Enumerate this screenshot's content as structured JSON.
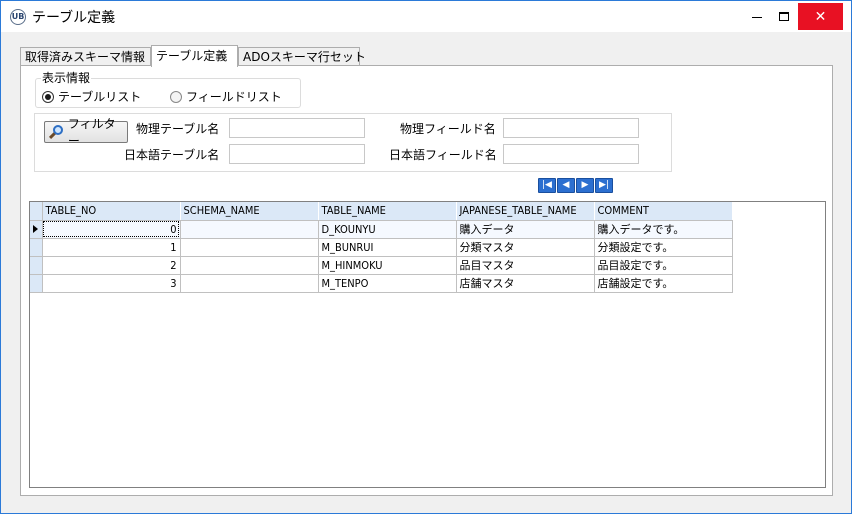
{
  "window": {
    "icon_text": "UB",
    "title": "テーブル定義",
    "close_symbol": "✕"
  },
  "tabs": [
    {
      "label": "取得済みスキーマ情報",
      "active": false
    },
    {
      "label": "テーブル定義",
      "active": true
    },
    {
      "label": "ADOスキーマ行セット",
      "active": false
    }
  ],
  "display_info": {
    "legend": "表示情報",
    "options": [
      {
        "label": "テーブルリスト",
        "checked": true
      },
      {
        "label": "フィールドリスト",
        "checked": false
      }
    ]
  },
  "filter": {
    "button_label": "フィルター",
    "physical_table_label": "物理テーブル名",
    "japanese_table_label": "日本語テーブル名",
    "physical_field_label": "物理フィールド名",
    "japanese_field_label": "日本語フィールド名",
    "physical_table_value": "",
    "japanese_table_value": "",
    "physical_field_value": "",
    "japanese_field_value": ""
  },
  "navigator": {
    "first": "|◀",
    "prev": "◀",
    "next": "▶",
    "last": "▶|"
  },
  "grid": {
    "columns": [
      "TABLE_NO",
      "SCHEMA_NAME",
      "TABLE_NAME",
      "JAPANESE_TABLE_NAME",
      "COMMENT"
    ],
    "rows": [
      {
        "table_no": "0",
        "schema_name": "",
        "table_name": "D_KOUNYU",
        "japanese_table_name": "購入データ",
        "comment": "購入データです。"
      },
      {
        "table_no": "1",
        "schema_name": "",
        "table_name": "M_BUNRUI",
        "japanese_table_name": "分類マスタ",
        "comment": "分類設定です。"
      },
      {
        "table_no": "2",
        "schema_name": "",
        "table_name": "M_HINMOKU",
        "japanese_table_name": "品目マスタ",
        "comment": "品目設定です。"
      },
      {
        "table_no": "3",
        "schema_name": "",
        "table_name": "M_TENPO",
        "japanese_table_name": "店舗マスタ",
        "comment": "店舗設定です。"
      }
    ]
  }
}
